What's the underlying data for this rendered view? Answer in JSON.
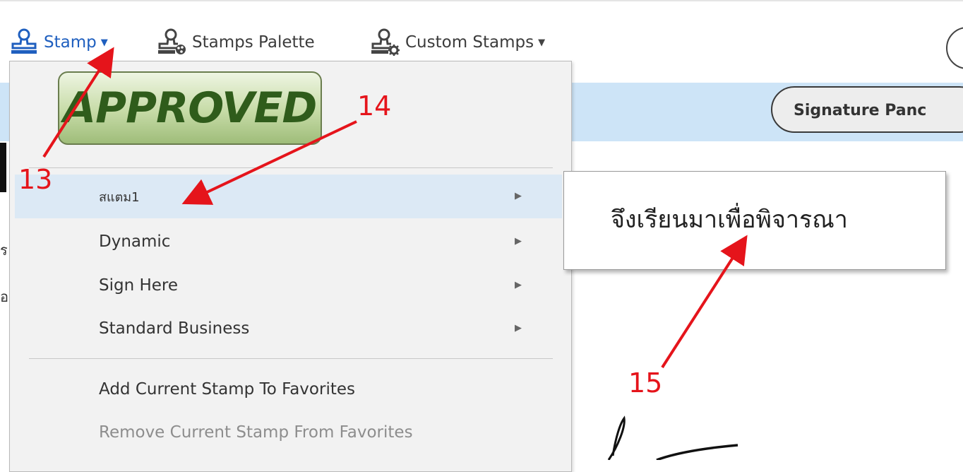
{
  "toolbar": {
    "stamp_label": "Stamp",
    "palette_label": "Stamps Palette",
    "custom_label": "Custom Stamps"
  },
  "header": {
    "signature_panel_label": "Signature Panc"
  },
  "stamp_preview": {
    "text": "APPROVED"
  },
  "menu": {
    "items": [
      {
        "label": "สแตม1",
        "has_submenu": true
      },
      {
        "label": "Dynamic",
        "has_submenu": true
      },
      {
        "label": "Sign Here",
        "has_submenu": true
      },
      {
        "label": "Standard Business",
        "has_submenu": true
      }
    ],
    "add_favorite_label": "Add Current Stamp To Favorites",
    "remove_favorite_label": "Remove Current Stamp From Favorites"
  },
  "submenu": {
    "items": [
      {
        "label": "จึงเรียนมาเพื่อพิจารณา"
      }
    ]
  },
  "left_edge": {
    "frag1": "ร",
    "frag2": "อ"
  },
  "annotations": {
    "n13": "13",
    "n14": "14",
    "n15": "15"
  },
  "colors": {
    "accent_blue": "#1f5fbf",
    "header_band": "#cde4f7",
    "annotation_red": "#e5141b",
    "stamp_green": "#2f5c1b",
    "menu_highlight": "#dce9f5"
  },
  "icons": {
    "stamp": "stamp-icon",
    "palette": "stamp-palette-icon",
    "custom": "stamp-gear-icon"
  }
}
